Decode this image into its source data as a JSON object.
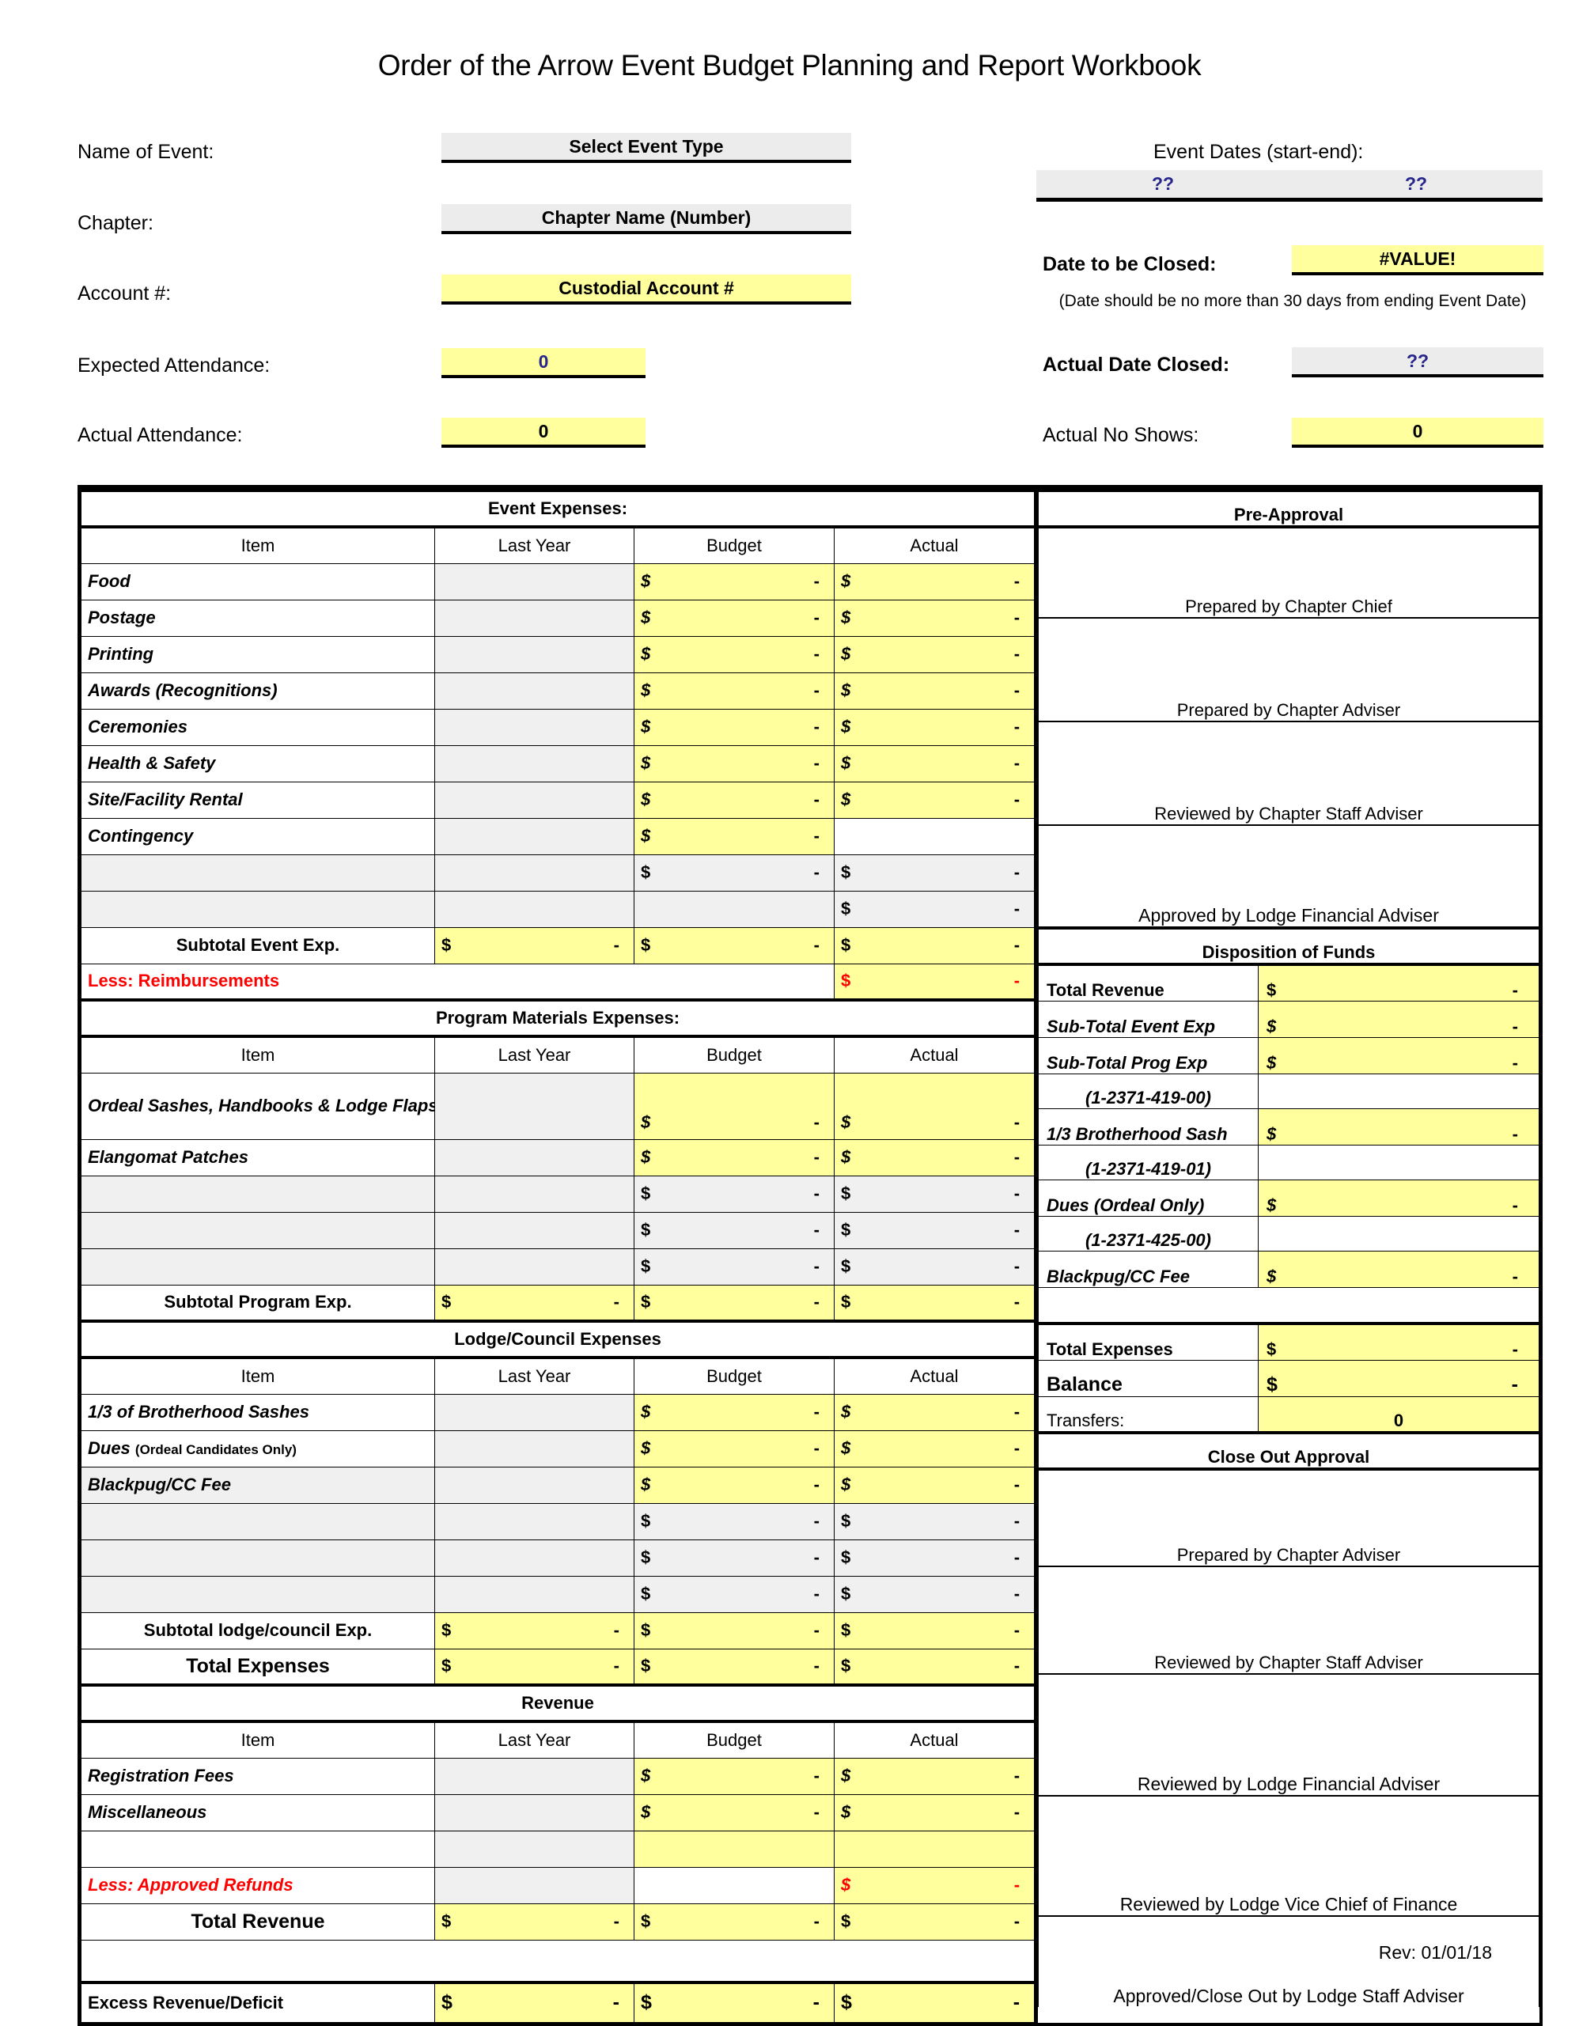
{
  "title": "Order of the Arrow Event Budget Planning and Report Workbook",
  "header": {
    "name_of_event_label": "Name of Event:",
    "name_of_event_value": "Select Event Type",
    "chapter_label": "Chapter:",
    "chapter_value": "Chapter Name (Number)",
    "account_label": "Account #:",
    "account_value": "Custodial Account #",
    "expected_attendance_label": "Expected Attendance:",
    "expected_attendance_value": "0",
    "actual_attendance_label": "Actual Attendance:",
    "actual_attendance_value": "0",
    "event_dates_label": "Event Dates (start-end):",
    "event_date_start": "??",
    "event_date_end": "??",
    "date_to_be_closed_label": "Date to be Closed:",
    "date_to_be_closed_value": "#VALUE!",
    "date_note": "(Date should be no more than 30 days from ending Event  Date)",
    "actual_date_closed_label": "Actual Date Closed:",
    "actual_date_closed_value": "??",
    "actual_no_shows_label": "Actual No Shows:",
    "actual_no_shows_value": "0"
  },
  "columns": {
    "item": "Item",
    "last_year": "Last Year",
    "budget": "Budget",
    "actual": "Actual"
  },
  "money": {
    "symbol": "$",
    "dash": "-"
  },
  "sections": {
    "event_expenses": {
      "heading": "Event Expenses:",
      "rows": [
        {
          "item": "Food"
        },
        {
          "item": "Postage"
        },
        {
          "item": "Printing"
        },
        {
          "item": "Awards (Recognitions)"
        },
        {
          "item": "Ceremonies"
        },
        {
          "item": "Health & Safety"
        },
        {
          "item": "Site/Facility Rental"
        },
        {
          "item": "Contingency"
        },
        {
          "item": ""
        },
        {
          "item": ""
        }
      ],
      "subtotal_label": "Subtotal Event Exp.",
      "less_label": "Less: Reimbursements"
    },
    "program_materials": {
      "heading": "Program Materials Expenses:",
      "rows": [
        {
          "item": "Ordeal Sashes, Handbooks & Lodge Flaps"
        },
        {
          "item": "Elangomat Patches"
        },
        {
          "item": ""
        },
        {
          "item": ""
        },
        {
          "item": ""
        }
      ],
      "subtotal_label": "Subtotal Program Exp."
    },
    "lodge_council": {
      "heading": "Lodge/Council Expenses",
      "rows": [
        {
          "item": "1/3 of Brotherhood Sashes"
        },
        {
          "item": "Dues ",
          "item_small": "(Ordeal Candidates Only)"
        },
        {
          "item": "Blackpug/CC Fee"
        },
        {
          "item": ""
        },
        {
          "item": ""
        },
        {
          "item": ""
        }
      ],
      "subtotal_label": "Subtotal lodge/council Exp.",
      "total_label": "Total Expenses"
    },
    "revenue": {
      "heading": "Revenue",
      "rows": [
        {
          "item": "Registration Fees"
        },
        {
          "item": "Miscellaneous"
        },
        {
          "item": ""
        }
      ],
      "less_label": "Less: Approved Refunds",
      "total_label": "Total Revenue",
      "excess_label": "Excess Revenue/Deficit"
    }
  },
  "pre_approval": {
    "heading": "Pre-Approval",
    "signatures": [
      "Prepared by Chapter Chief",
      "Prepared by Chapter Adviser",
      "Reviewed by Chapter Staff Adviser",
      "Approved by Lodge Financial Adviser"
    ]
  },
  "disposition": {
    "heading": "Disposition of Funds",
    "rows": [
      {
        "label": "Total Revenue",
        "style": "bold",
        "account": ""
      },
      {
        "label": "Sub-Total Event Exp",
        "style": "italic",
        "account": ""
      },
      {
        "label": "Sub-Total Prog Exp",
        "style": "italic",
        "account": "(1-2371-419-00)"
      },
      {
        "label": "1/3 Brotherhood Sash",
        "style": "italic",
        "account": "(1-2371-419-01)"
      },
      {
        "label": "Dues (Ordeal Only)",
        "style": "italic",
        "account": "(1-2371-425-00)"
      },
      {
        "label": "Blackpug/CC Fee",
        "style": "italic",
        "account": ""
      }
    ],
    "total_expenses_label": "Total Expenses",
    "balance_label": "Balance",
    "transfers_label": "Transfers:",
    "transfers_value": "0"
  },
  "close_out": {
    "heading": "Close Out Approval",
    "signatures": [
      "Prepared by Chapter Adviser",
      "Reviewed by Chapter Staff Adviser",
      "Reviewed by Lodge Financial Adviser",
      "Reviewed by Lodge Vice Chief of Finance",
      "Approved/Close Out by Lodge Staff Adviser"
    ]
  },
  "revision": "Rev: 01/01/18"
}
